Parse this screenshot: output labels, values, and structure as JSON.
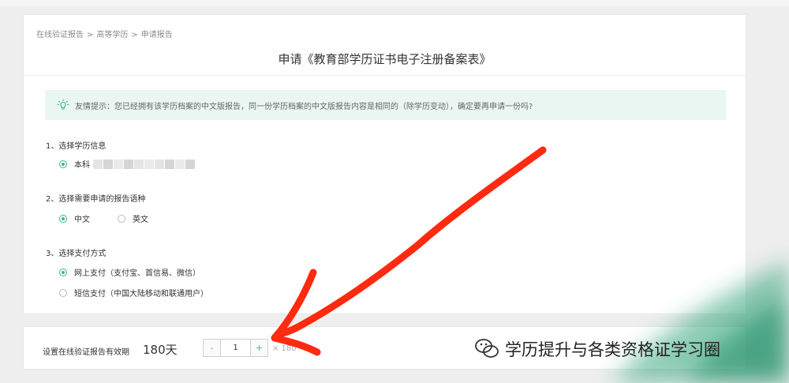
{
  "breadcrumb": {
    "items": [
      "在线验证报告",
      "高等学历",
      "申请报告"
    ],
    "separator": ">"
  },
  "page_title": "申请《教育部学历证书电子注册备案表》",
  "tip": {
    "icon": "lightbulb-icon",
    "text": "友情提示：您已经拥有该学历档案的中文版报告，同一份学历档案的中文版报告内容是相同的（除学历变动），确定要再申请一份吗?"
  },
  "sections": {
    "education": {
      "title": "1、选择学历信息",
      "options": [
        {
          "label": "本科",
          "checked": true
        }
      ]
    },
    "language": {
      "title": "2、选择需要申请的报告语种",
      "options": [
        {
          "label": "中文",
          "checked": true
        },
        {
          "label": "英文",
          "checked": false
        }
      ]
    },
    "payment": {
      "title": "3、选择支付方式",
      "options": [
        {
          "label": "网上支付（支付宝、首信易、微信）",
          "checked": true
        },
        {
          "label": "短信支付（中国大陆移动和联通用户）",
          "checked": false
        }
      ]
    }
  },
  "validity": {
    "label": "设置在线验证报告有效期",
    "value": "180天",
    "quantity": "1",
    "minus": "-",
    "plus": "+",
    "multiplier": "× 180"
  },
  "colors": {
    "accent": "#3bb58f",
    "tip_bg": "#eaf6f2",
    "arrow": "#ff2a10",
    "watermark_green": "#2fa27a"
  },
  "watermark": {
    "icon": "wechat-icon",
    "text": "学历提升与各类资格证学习圈"
  }
}
